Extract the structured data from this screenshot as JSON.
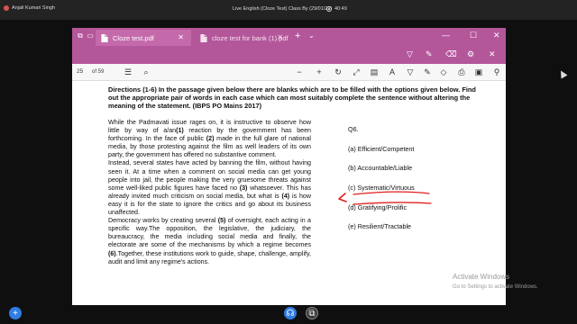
{
  "session": {
    "presenter_name": "Anjali Kumari Singh",
    "title": "Live English (Cloze Test) Class By (29/01/21)",
    "elapsed": "40:49"
  },
  "browser": {
    "tabs": [
      {
        "label": "Cloze test.pdf",
        "active": true
      },
      {
        "label": "cloze test for bank (1).pdf",
        "active": false
      }
    ],
    "new_tab_label": "+",
    "tab_dropdown": "⌄",
    "window_controls": [
      "—",
      "☐",
      "✕"
    ]
  },
  "pdf_toolbar": {
    "current_page": "25",
    "page_of": "of 59",
    "accent_color": "#b4569a"
  },
  "document": {
    "directions": "Directions (1-6) In the passage given below there are blanks which are to be filled with the options given below. Find out the appropriate pair of words in each case which can most suitably complete the sentence without altering the meaning of the statement. (IBPS PO Mains 2017)",
    "passage": [
      {
        "pre": "While the Padmavati issue rages on, it is instructive to observe how little by way of a/an",
        "blank": "(1)",
        "post": " reaction by the government has been forthcoming. In the face of public "
      },
      {
        "pre": "",
        "blank": "(2)",
        "post": " made in the full glare of national media, by those protesting against the film as well leaders of its own party, the government has offered no substantive comment."
      },
      {
        "pre": "Instead, several states have acted by banning the film, without having seen it. At a time when a comment on social media can get young people into jail, the people making the very gruesome threats against some well-liked public figures have faced no ",
        "blank": "(3)",
        "post": " whatsoever. This has already invited much criticism on social media, but what is "
      },
      {
        "pre": "",
        "blank": "(4)",
        "post": " is how easy it is for the state to ignore the critics and go about its business unaffected."
      },
      {
        "pre": "Democracy works by creating several ",
        "blank": "(5)",
        "post": " of oversight, each acting in a specific way.The opposition, the legislative, the judiciary, the bureaucracy, the media including social media and finally, the electorate are some of the mechanisms by which a regime becomes "
      },
      {
        "pre": "",
        "blank": "(6)",
        "post": ".Together, these institutions work to guide, shape, challenge, amplify, audit and limit any regime's actions."
      }
    ],
    "question": {
      "number": "Q6.",
      "options": [
        "(a) Efficient/Competent",
        "(b) Accountable/Liable",
        "(c) Systematic/Virtuous",
        "(d) Gratifying/Prolific",
        "(e) Resilient/Tractable"
      ],
      "annotation_color": "#e0201e"
    }
  },
  "watermark": {
    "title": "Activate Windows",
    "subtitle": "Go to Settings to activate Windows."
  }
}
